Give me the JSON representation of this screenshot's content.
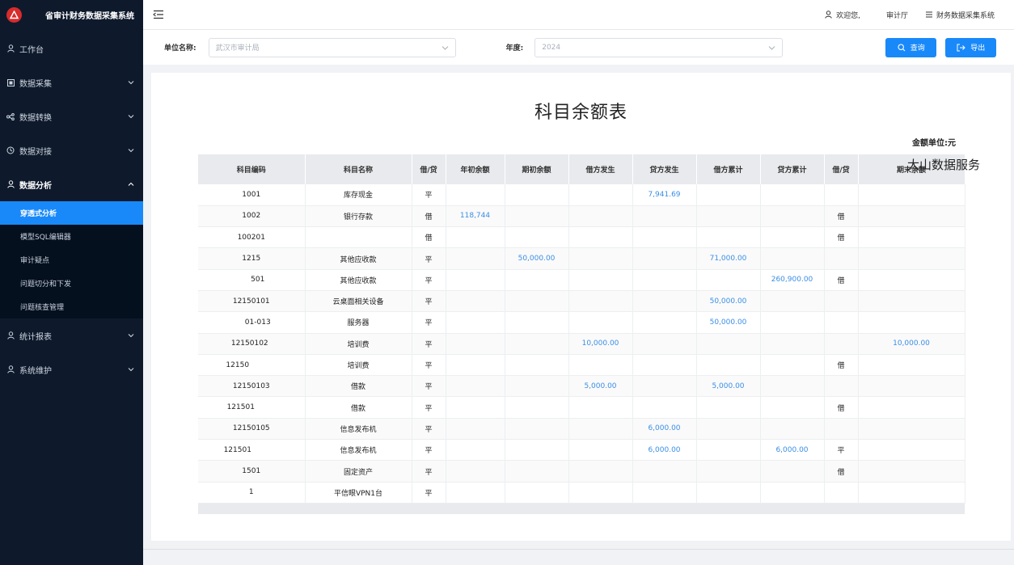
{
  "app": {
    "title": "省审计财务数据采集系统"
  },
  "header": {
    "welcome": "欢迎您,",
    "org": "审计厅",
    "system": "财务数据采集系统"
  },
  "sidebar": {
    "items": [
      {
        "label": "工作台",
        "icon": "user-icon"
      },
      {
        "label": "数据采集",
        "icon": "grid-icon"
      },
      {
        "label": "数据转换",
        "icon": "share-icon"
      },
      {
        "label": "数据对接",
        "icon": "clock-icon"
      },
      {
        "label": "数据分析",
        "icon": "user-icon"
      },
      {
        "label": "统计报表",
        "icon": "user-icon"
      },
      {
        "label": "系统维护",
        "icon": "user-icon"
      }
    ],
    "submenu": [
      "穿透式分析",
      "模型SQL编辑器",
      "审计疑点",
      "问题切分和下发",
      "问题核查管理"
    ]
  },
  "filters": {
    "unit_label": "单位名称:",
    "unit_value": "武汉市审计局",
    "year_label": "年度:",
    "year_value": "2024",
    "query_button": "查询",
    "export_button": "导出"
  },
  "report": {
    "title": "科目余额表",
    "unit": "金额单位:元",
    "watermark": "大山数据服务",
    "columns": [
      "科目编码",
      "科目名称",
      "借/贷",
      "年初余额",
      "期初余额",
      "借方发生",
      "贷方发生",
      "借方累计",
      "贷方累计",
      "借/贷",
      "期末余额"
    ],
    "rows": [
      [
        "1001",
        "库存现金",
        "平",
        "",
        "",
        "",
        "7,941.69",
        "",
        "",
        "",
        ""
      ],
      [
        "1002",
        "银行存款",
        "借",
        "118,744",
        "",
        "",
        "",
        "",
        "",
        "借",
        ""
      ],
      [
        "100201",
        "",
        "借",
        "",
        "",
        "",
        "",
        "",
        "",
        "借",
        ""
      ],
      [
        "1215",
        "其他应收款",
        "平",
        "",
        "50,000.00",
        "",
        "",
        "71,000.00",
        "",
        "",
        ""
      ],
      [
        "501",
        "其他应收款",
        "平",
        "",
        "",
        "",
        "",
        "",
        "260,900.00",
        "借",
        ""
      ],
      [
        "12150101",
        "云桌面相关设备",
        "平",
        "",
        "",
        "",
        "",
        "50,000.00",
        "",
        "",
        ""
      ],
      [
        "01-013",
        "服务器",
        "平",
        "",
        "",
        "",
        "",
        "50,000.00",
        "",
        "",
        ""
      ],
      [
        "12150102",
        "培训费",
        "平",
        "",
        "",
        "10,000.00",
        "",
        "",
        "",
        "",
        "10,000.00"
      ],
      [
        "12150",
        "培训费",
        "平",
        "",
        "",
        "",
        "",
        "",
        "",
        "借",
        ""
      ],
      [
        "12150103",
        "借款",
        "平",
        "",
        "",
        "5,000.00",
        "",
        "5,000.00",
        "",
        "",
        ""
      ],
      [
        "121501",
        "借款",
        "平",
        "",
        "",
        "",
        "",
        "",
        "",
        "借",
        ""
      ],
      [
        "12150105",
        "信息发布机",
        "平",
        "",
        "",
        "",
        "6,000.00",
        "",
        "",
        "",
        ""
      ],
      [
        "121501",
        "信息发布机",
        "平",
        "",
        "",
        "",
        "6,000.00",
        "",
        "6,000.00",
        "平",
        ""
      ],
      [
        "1501",
        "固定资产",
        "平",
        "",
        "",
        "",
        "",
        "",
        "",
        "借",
        ""
      ],
      [
        "1",
        "平信眼VPN1台",
        "平",
        "",
        "",
        "",
        "",
        "",
        "",
        "",
        ""
      ]
    ]
  }
}
